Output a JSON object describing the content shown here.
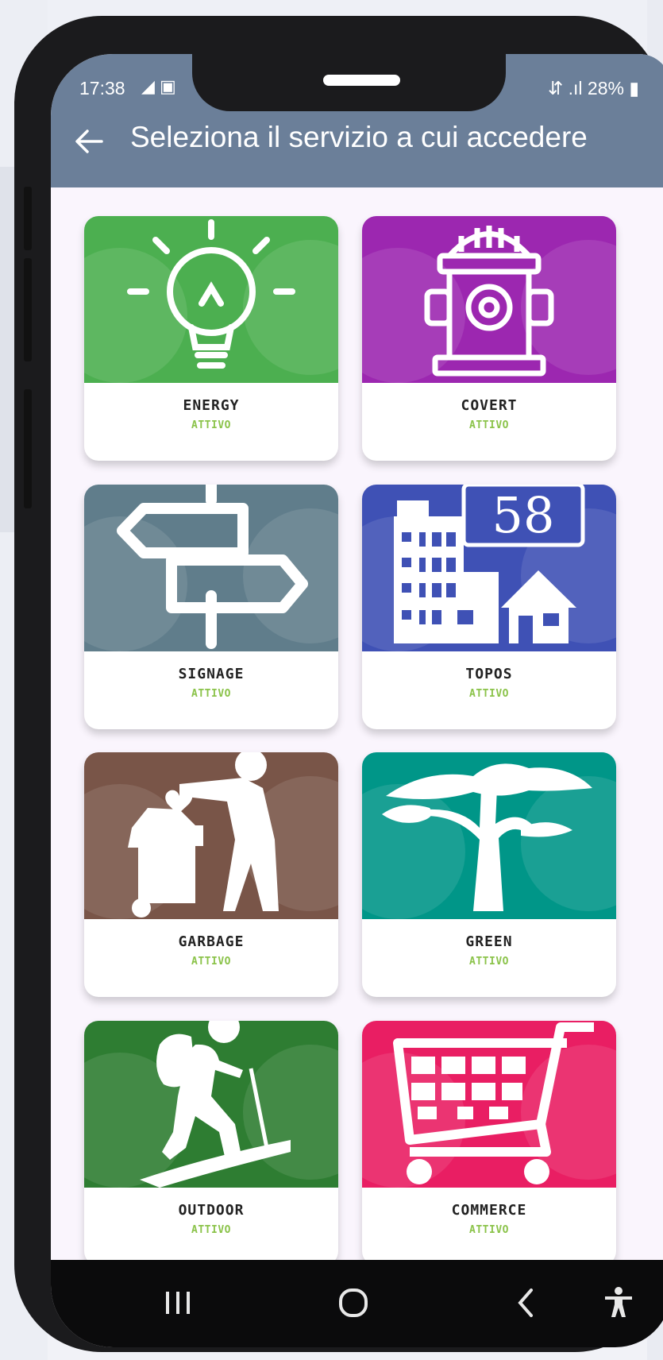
{
  "status_bar": {
    "time": "17:38",
    "left_icons": "◢ ▣",
    "right": "⇵ .ıl 28% ▮"
  },
  "app_bar": {
    "title": "Seleziona il servizio a cui accedere"
  },
  "services": [
    {
      "name": "ENERGY",
      "status": "ATTIVO",
      "color": "#4caf50",
      "icon": "lightbulb-icon"
    },
    {
      "name": "COVERT",
      "status": "ATTIVO",
      "color": "#9c27b0",
      "icon": "fire-hydrant-icon"
    },
    {
      "name": "SIGNAGE",
      "status": "ATTIVO",
      "color": "#607d8b",
      "icon": "signpost-icon"
    },
    {
      "name": "TOPOS",
      "status": "ATTIVO",
      "color": "#3f51b5",
      "icon": "buildings-house-number-icon",
      "badge": "58"
    },
    {
      "name": "GARBAGE",
      "status": "ATTIVO",
      "color": "#795548",
      "icon": "trash-person-icon"
    },
    {
      "name": "GREEN",
      "status": "ATTIVO",
      "color": "#009688",
      "icon": "tree-icon"
    },
    {
      "name": "OUTDOOR",
      "status": "ATTIVO",
      "color": "#2e7d32",
      "icon": "hiker-icon"
    },
    {
      "name": "COMMERCE",
      "status": "ATTIVO",
      "color": "#e91e63",
      "icon": "shopping-cart-icon"
    }
  ],
  "nav_bar": {
    "recents": "recents-icon",
    "home": "home-icon",
    "back": "back-icon",
    "accessibility": "accessibility-icon"
  }
}
